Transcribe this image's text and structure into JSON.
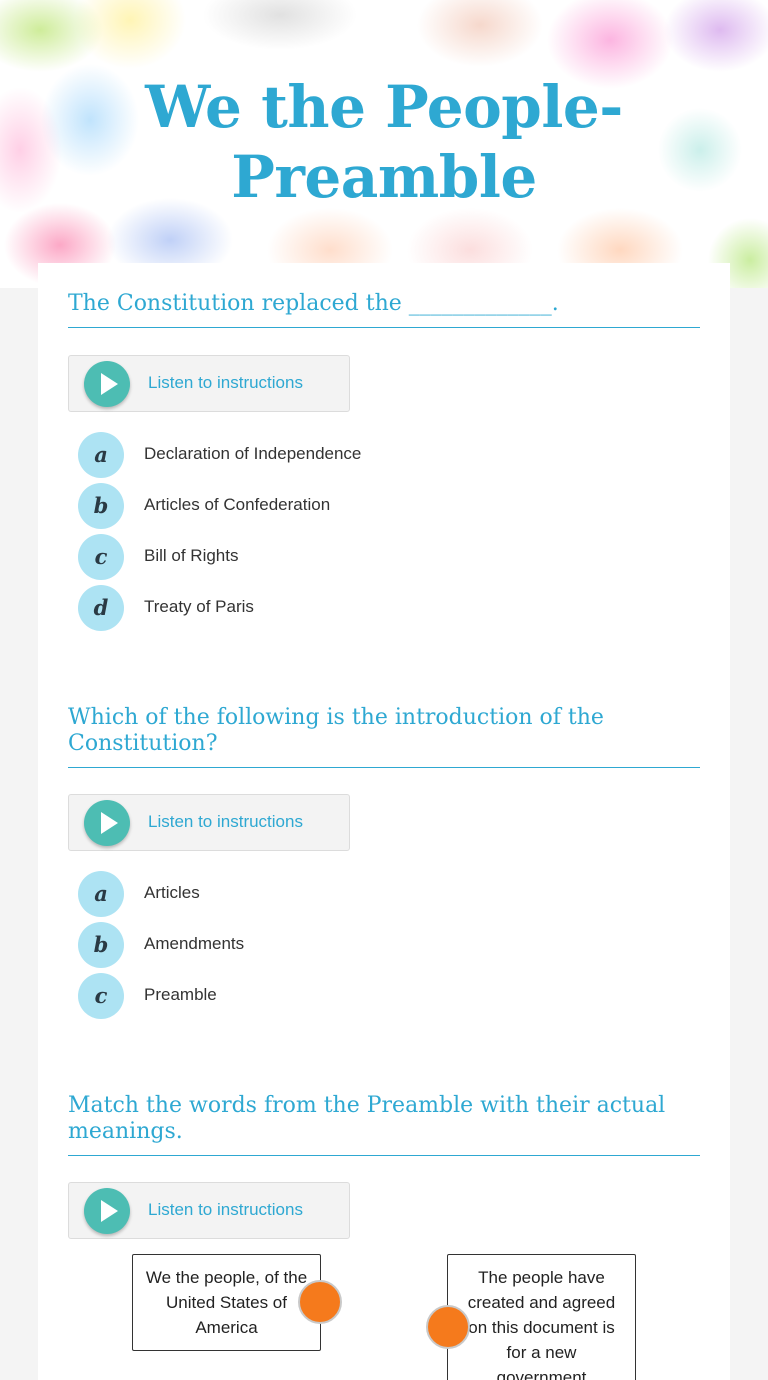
{
  "header": {
    "title": "We the People- Preamble"
  },
  "listen_label": "Listen to instructions",
  "questions": [
    {
      "title": "The Constitution replaced the _____________.",
      "options": [
        {
          "letter": "a",
          "text": "Declaration of Independence"
        },
        {
          "letter": "b",
          "text": "Articles of Confederation"
        },
        {
          "letter": "c",
          "text": "Bill of Rights"
        },
        {
          "letter": "d",
          "text": "Treaty of Paris"
        }
      ]
    },
    {
      "title": "Which of the following is the introduction of the Constitution?",
      "options": [
        {
          "letter": "a",
          "text": "Articles"
        },
        {
          "letter": "b",
          "text": "Amendments"
        },
        {
          "letter": "c",
          "text": "Preamble"
        }
      ]
    },
    {
      "title": "Match the words from the Preamble with their actual meanings.",
      "left_items": [
        "We the people, of the United States of America"
      ],
      "right_items": [
        "The people have created and agreed on this document is for a new government"
      ]
    }
  ],
  "colors": {
    "accent": "#2ea8d2",
    "play": "#4dbdb3",
    "letter_bubble": "#ade3f3",
    "match_dot": "#f57a1c"
  }
}
